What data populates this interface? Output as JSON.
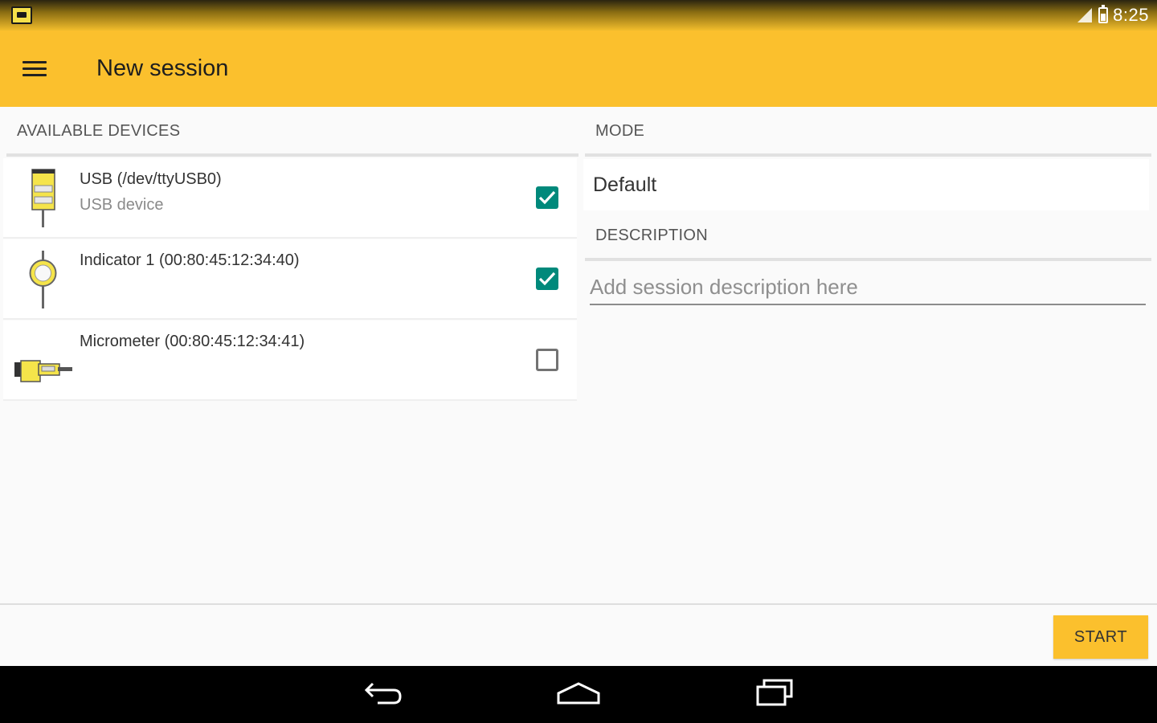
{
  "status_bar": {
    "time": "8:25",
    "icons": [
      "app-notification-icon",
      "signal-icon",
      "battery-icon"
    ]
  },
  "app_bar": {
    "title": "New session",
    "menu_icon": "hamburger-menu-icon",
    "background_color": "#fbc02d"
  },
  "devices": {
    "header": "AVAILABLE DEVICES",
    "items": [
      {
        "name": "USB (/dev/ttyUSB0)",
        "subtitle": "USB device",
        "checked": true,
        "icon": "usb-caliper-icon"
      },
      {
        "name": "Indicator 1 (00:80:45:12:34:40)",
        "subtitle": "",
        "checked": true,
        "icon": "dial-indicator-icon"
      },
      {
        "name": "Micrometer (00:80:45:12:34:41)",
        "subtitle": "",
        "checked": false,
        "icon": "micrometer-icon"
      }
    ]
  },
  "mode": {
    "header": "MODE",
    "value": "Default"
  },
  "description": {
    "header": "DESCRIPTION",
    "placeholder": "Add session description here",
    "value": ""
  },
  "actions": {
    "start_label": "START"
  },
  "navigation": {
    "buttons": [
      "back-icon",
      "home-icon",
      "recent-apps-icon"
    ]
  },
  "colors": {
    "accent": "#fbc02d",
    "checkbox": "#00897b"
  }
}
